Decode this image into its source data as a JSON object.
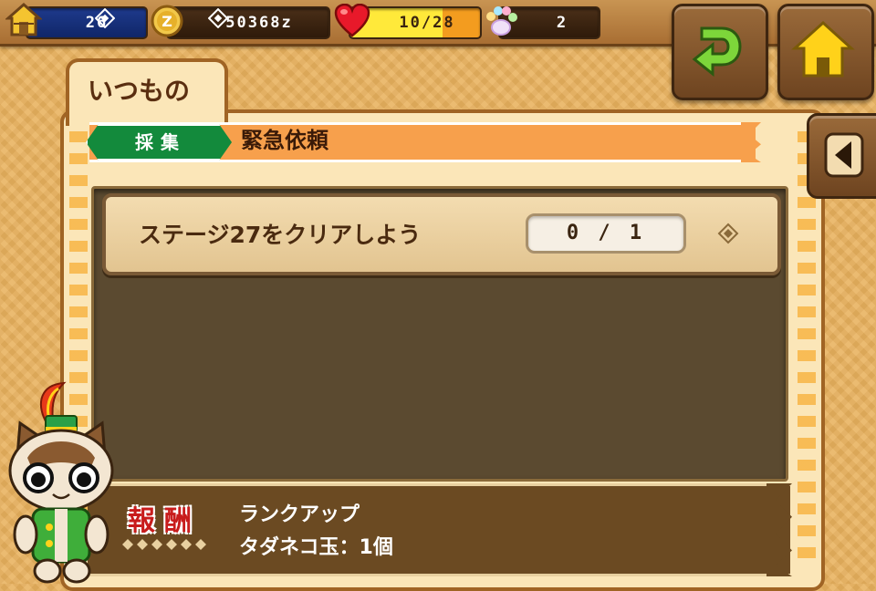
{
  "status_bar": {
    "rank": "26",
    "zenny": "50368z",
    "stamina": "10/28",
    "stamina_fill": 0.357,
    "paw_count": "2"
  },
  "icons": {
    "rank": "house-icon",
    "zenny": "coin-icon",
    "stamina": "heart-icon",
    "paw": "paw-icon",
    "back": "return-arrow-icon",
    "home": "home-icon",
    "side": "triangle-left-icon"
  },
  "tab": {
    "label": "いつもの"
  },
  "quest": {
    "type_label": "採集",
    "title": "緊急依頼"
  },
  "missions": [
    {
      "text": "ステージ27をクリアしよう",
      "progress": "0 / 1"
    }
  ],
  "reward": {
    "label": "報酬",
    "lines": [
      "ランクアップ",
      "タダネコ玉：1個"
    ]
  },
  "colors": {
    "accent_orange": "#f7a04c",
    "quest_type_green": "#138a3c",
    "reward_red": "#c81c1c",
    "back_arrow_green": "#7dd63a",
    "home_yellow": "#ffd21a"
  }
}
